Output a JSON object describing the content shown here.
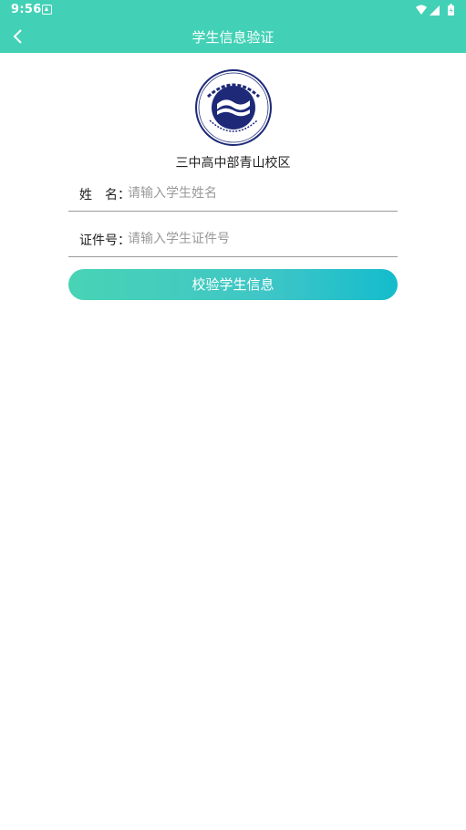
{
  "status_bar": {
    "time": "9:56",
    "icons": [
      "notification-icon",
      "wifi-icon",
      "signal-icon",
      "battery-icon"
    ]
  },
  "app_bar": {
    "title": "学生信息验证",
    "back_icon": "chevron-left-icon"
  },
  "logo": {
    "name": "school-emblem"
  },
  "school_name": "三中高中部青山校区",
  "form": {
    "name_label": "姓　名：",
    "name_placeholder": "请输入学生姓名",
    "name_value": "",
    "id_label": "证件号：",
    "id_placeholder": "请输入学生证件号",
    "id_value": ""
  },
  "verify_button": "校验学生信息",
  "colors": {
    "primary": "#42d1b6",
    "button_gradient_start": "#48d3b5",
    "button_gradient_end": "#14bccd",
    "emblem_navy": "#1e2a78"
  }
}
